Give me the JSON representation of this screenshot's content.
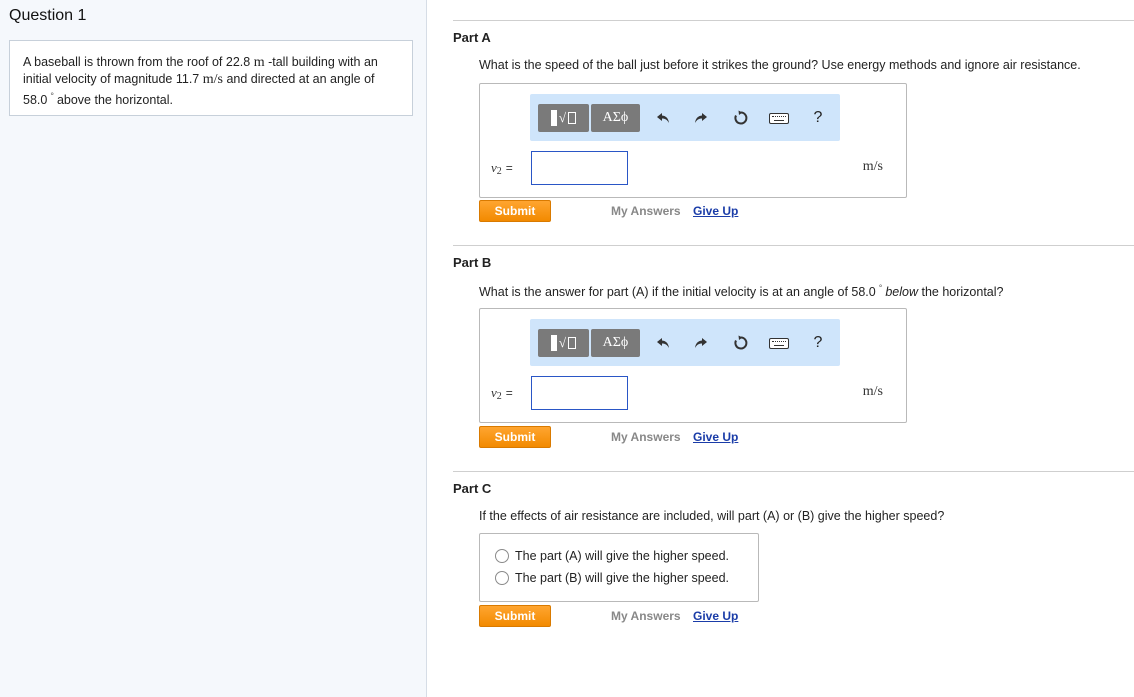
{
  "question": {
    "title": "Question 1"
  },
  "problem": {
    "text_1": "A baseball is thrown from the roof of 22.8",
    "unit_m": "m",
    "text_2": "-tall building with an initial velocity of magnitude 11.7",
    "unit_ms": "m/s",
    "text_3": "and directed at an angle of 58.0",
    "deg": "°",
    "text_4": "above the horizontal."
  },
  "toolbar": {
    "templates_icon": "templates-icon",
    "greek_label": "ΑΣϕ",
    "undo_icon": "undo-icon",
    "redo_icon": "redo-icon",
    "reset_icon": "reset-icon",
    "keyboard_icon": "keyboard-icon",
    "help_label": "?"
  },
  "part_a": {
    "title": "Part A",
    "question": "What is the speed of the ball just before it strikes the ground? Use energy methods and ignore air resistance.",
    "var_symbol": "v",
    "var_sub": "2",
    "equals": "=",
    "input_value": "",
    "unit": "m/s",
    "submit": "Submit",
    "my_answers": "My Answers",
    "give_up": "Give Up"
  },
  "part_b": {
    "title": "Part B",
    "question_1": "What is the answer for part (A) if the initial velocity is at an angle of 58.0",
    "deg": "°",
    "question_em": "below",
    "question_2": "the horizontal?",
    "var_symbol": "v",
    "var_sub": "2",
    "equals": "=",
    "input_value": "",
    "unit": "m/s",
    "submit": "Submit",
    "my_answers": "My Answers",
    "give_up": "Give Up"
  },
  "part_c": {
    "title": "Part C",
    "question": "If the effects of air resistance are included, will part (A) or (B) give the higher speed?",
    "choices": [
      "The part (A) will give the higher speed.",
      "The part (B) will give the higher speed."
    ],
    "submit": "Submit",
    "my_answers": "My Answers",
    "give_up": "Give Up"
  },
  "colors": {
    "accent_orange": "#f28a00",
    "link_blue": "#1a3ca8",
    "toolbar_bg": "#cfe5fb"
  }
}
